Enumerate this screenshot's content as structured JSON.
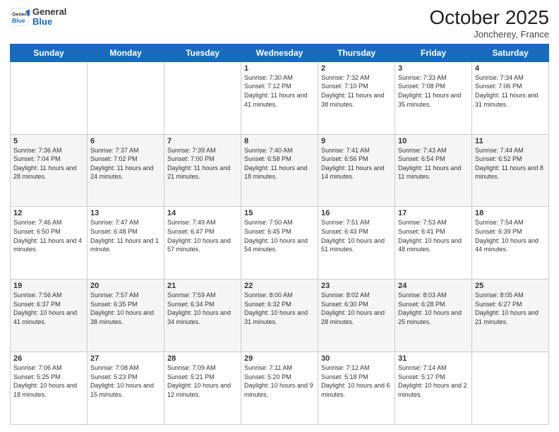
{
  "header": {
    "logo_general": "General",
    "logo_blue": "Blue",
    "month_title": "October 2025",
    "location": "Joncherey, France"
  },
  "weekdays": [
    "Sunday",
    "Monday",
    "Tuesday",
    "Wednesday",
    "Thursday",
    "Friday",
    "Saturday"
  ],
  "weeks": [
    [
      {
        "day": "",
        "info": ""
      },
      {
        "day": "",
        "info": ""
      },
      {
        "day": "",
        "info": ""
      },
      {
        "day": "1",
        "info": "Sunrise: 7:30 AM\nSunset: 7:12 PM\nDaylight: 11 hours\nand 41 minutes."
      },
      {
        "day": "2",
        "info": "Sunrise: 7:32 AM\nSunset: 7:10 PM\nDaylight: 11 hours\nand 38 minutes."
      },
      {
        "day": "3",
        "info": "Sunrise: 7:33 AM\nSunset: 7:08 PM\nDaylight: 11 hours\nand 35 minutes."
      },
      {
        "day": "4",
        "info": "Sunrise: 7:34 AM\nSunset: 7:06 PM\nDaylight: 11 hours\nand 31 minutes."
      }
    ],
    [
      {
        "day": "5",
        "info": "Sunrise: 7:36 AM\nSunset: 7:04 PM\nDaylight: 11 hours\nand 28 minutes."
      },
      {
        "day": "6",
        "info": "Sunrise: 7:37 AM\nSunset: 7:02 PM\nDaylight: 11 hours\nand 24 minutes."
      },
      {
        "day": "7",
        "info": "Sunrise: 7:39 AM\nSunset: 7:00 PM\nDaylight: 11 hours\nand 21 minutes."
      },
      {
        "day": "8",
        "info": "Sunrise: 7:40 AM\nSunset: 6:58 PM\nDaylight: 11 hours\nand 18 minutes."
      },
      {
        "day": "9",
        "info": "Sunrise: 7:41 AM\nSunset: 6:56 PM\nDaylight: 11 hours\nand 14 minutes."
      },
      {
        "day": "10",
        "info": "Sunrise: 7:43 AM\nSunset: 6:54 PM\nDaylight: 11 hours\nand 11 minutes."
      },
      {
        "day": "11",
        "info": "Sunrise: 7:44 AM\nSunset: 6:52 PM\nDaylight: 11 hours\nand 8 minutes."
      }
    ],
    [
      {
        "day": "12",
        "info": "Sunrise: 7:46 AM\nSunset: 6:50 PM\nDaylight: 11 hours\nand 4 minutes."
      },
      {
        "day": "13",
        "info": "Sunrise: 7:47 AM\nSunset: 6:48 PM\nDaylight: 11 hours\nand 1 minute."
      },
      {
        "day": "14",
        "info": "Sunrise: 7:49 AM\nSunset: 6:47 PM\nDaylight: 10 hours\nand 57 minutes."
      },
      {
        "day": "15",
        "info": "Sunrise: 7:50 AM\nSunset: 6:45 PM\nDaylight: 10 hours\nand 54 minutes."
      },
      {
        "day": "16",
        "info": "Sunrise: 7:51 AM\nSunset: 6:43 PM\nDaylight: 10 hours\nand 51 minutes."
      },
      {
        "day": "17",
        "info": "Sunrise: 7:53 AM\nSunset: 6:41 PM\nDaylight: 10 hours\nand 48 minutes."
      },
      {
        "day": "18",
        "info": "Sunrise: 7:54 AM\nSunset: 6:39 PM\nDaylight: 10 hours\nand 44 minutes."
      }
    ],
    [
      {
        "day": "19",
        "info": "Sunrise: 7:56 AM\nSunset: 6:37 PM\nDaylight: 10 hours\nand 41 minutes."
      },
      {
        "day": "20",
        "info": "Sunrise: 7:57 AM\nSunset: 6:35 PM\nDaylight: 10 hours\nand 38 minutes."
      },
      {
        "day": "21",
        "info": "Sunrise: 7:59 AM\nSunset: 6:34 PM\nDaylight: 10 hours\nand 34 minutes."
      },
      {
        "day": "22",
        "info": "Sunrise: 8:00 AM\nSunset: 6:32 PM\nDaylight: 10 hours\nand 31 minutes."
      },
      {
        "day": "23",
        "info": "Sunrise: 8:02 AM\nSunset: 6:30 PM\nDaylight: 10 hours\nand 28 minutes."
      },
      {
        "day": "24",
        "info": "Sunrise: 8:03 AM\nSunset: 6:28 PM\nDaylight: 10 hours\nand 25 minutes."
      },
      {
        "day": "25",
        "info": "Sunrise: 8:05 AM\nSunset: 6:27 PM\nDaylight: 10 hours\nand 21 minutes."
      }
    ],
    [
      {
        "day": "26",
        "info": "Sunrise: 7:06 AM\nSunset: 5:25 PM\nDaylight: 10 hours\nand 18 minutes."
      },
      {
        "day": "27",
        "info": "Sunrise: 7:08 AM\nSunset: 5:23 PM\nDaylight: 10 hours\nand 15 minutes."
      },
      {
        "day": "28",
        "info": "Sunrise: 7:09 AM\nSunset: 5:21 PM\nDaylight: 10 hours\nand 12 minutes."
      },
      {
        "day": "29",
        "info": "Sunrise: 7:11 AM\nSunset: 5:20 PM\nDaylight: 10 hours\nand 9 minutes."
      },
      {
        "day": "30",
        "info": "Sunrise: 7:12 AM\nSunset: 5:18 PM\nDaylight: 10 hours\nand 6 minutes."
      },
      {
        "day": "31",
        "info": "Sunrise: 7:14 AM\nSunset: 5:17 PM\nDaylight: 10 hours\nand 2 minutes."
      },
      {
        "day": "",
        "info": ""
      }
    ]
  ]
}
